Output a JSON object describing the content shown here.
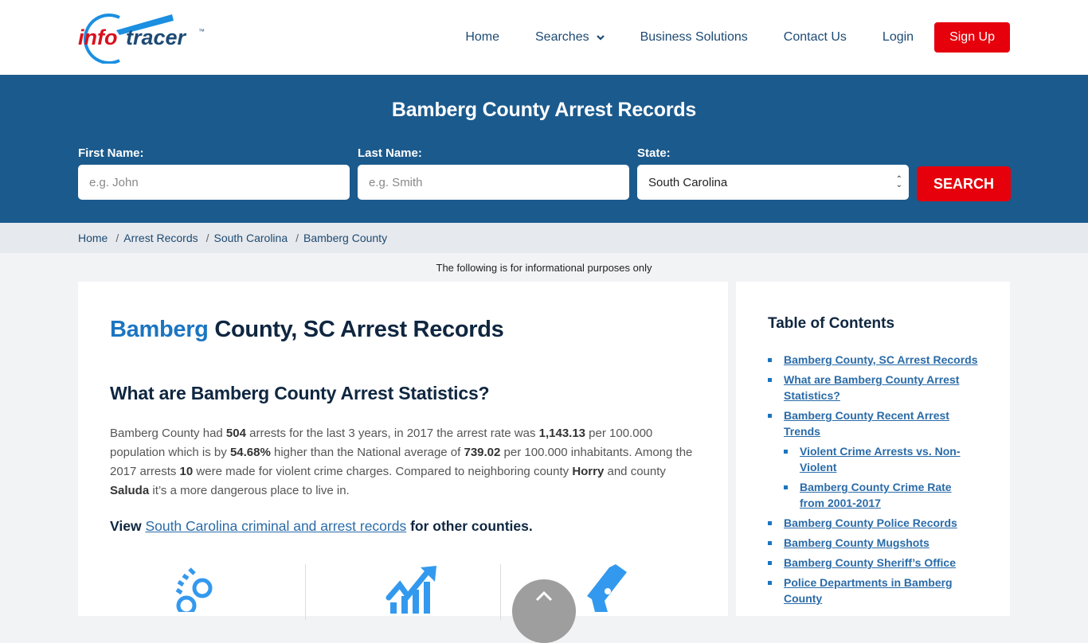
{
  "brand": {
    "logo_info": "info",
    "logo_tracer": "tracer",
    "logo_tm": "™"
  },
  "nav": {
    "items": [
      {
        "label": "Home"
      },
      {
        "label": "Searches"
      },
      {
        "label": "Business Solutions"
      },
      {
        "label": "Contact Us"
      },
      {
        "label": "Login"
      }
    ],
    "signup_label": "Sign Up"
  },
  "hero": {
    "title": "Bamberg County Arrest Records",
    "first_name_label": "First Name:",
    "first_name_placeholder": "e.g. John",
    "first_name_value": "",
    "last_name_label": "Last Name:",
    "last_name_placeholder": "e.g. Smith",
    "last_name_value": "",
    "state_label": "State:",
    "state_selected": "South Carolina",
    "search_label": "SEARCH"
  },
  "breadcrumb": [
    "Home",
    "Arrest Records",
    "South Carolina",
    "Bamberg County"
  ],
  "notice": "The following is for informational purposes only",
  "article": {
    "title_accent": "Bamberg",
    "title_rest": " County, SC Arrest Records",
    "stats_heading": "What are Bamberg County Arrest Statistics?",
    "stats": {
      "t1": "Bamberg County had ",
      "arrests": "504",
      "t2": " arrests for the last 3 years, in 2017 the arrest rate was ",
      "rate": "1,143.13",
      "t3": " per 100.000 population which is by ",
      "pct": "54.68%",
      "t4": " higher than the National average of ",
      "national": "739.02",
      "t5": " per 100.000 inhabitants. Among the 2017 arrests ",
      "violent": "10",
      "t6": " were made for violent crime charges. Compared to neighboring county ",
      "county1": "Horry",
      "t7": " and county ",
      "county2": "Saluda",
      "t8": " it’s a more dangerous place to live in."
    },
    "view_prefix": "View ",
    "view_link": "South Carolina criminal and arrest records",
    "view_suffix": " for other counties."
  },
  "toc": {
    "title": "Table of Contents",
    "items": [
      {
        "label": "Bamberg County, SC Arrest Records"
      },
      {
        "label": "What are Bamberg County Arrest Statistics?"
      },
      {
        "label": "Bamberg County Recent Arrest Trends"
      },
      {
        "label": "Violent Crime Arrests vs. Non-Violent"
      },
      {
        "label": "Bamberg County Crime Rate from 2001-2017"
      },
      {
        "label": "Bamberg County Police Records"
      },
      {
        "label": "Bamberg County Mugshots"
      },
      {
        "label": "Bamberg County Sheriff’s Office"
      },
      {
        "label": "Police Departments in Bamberg County"
      }
    ]
  },
  "colors": {
    "brand_blue": "#1b5a8d",
    "accent_red": "#e5000b",
    "link_blue": "#2a6ba8",
    "icon_blue": "#3399ee"
  }
}
